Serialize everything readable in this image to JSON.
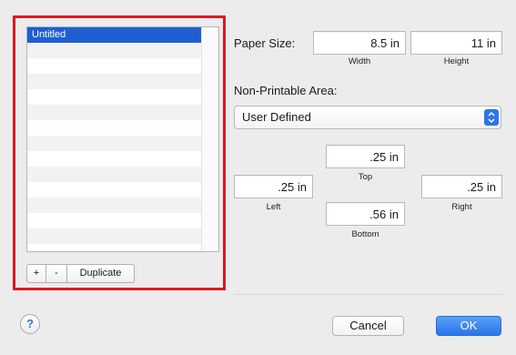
{
  "list": {
    "items": [
      "Untitled"
    ],
    "empty_rows": 13,
    "selected_color": "#1f5fd1"
  },
  "list_buttons": {
    "add": "+",
    "remove": "-",
    "duplicate": "Duplicate"
  },
  "paper_size": {
    "label": "Paper Size:",
    "width_value": "8.5 in",
    "width_caption": "Width",
    "height_value": "11 in",
    "height_caption": "Height"
  },
  "non_printable": {
    "label": "Non-Printable Area:",
    "selected": "User Defined",
    "top_value": ".25 in",
    "top_caption": "Top",
    "left_value": ".25 in",
    "left_caption": "Left",
    "right_value": ".25 in",
    "right_caption": "Right",
    "bottom_value": ".56 in",
    "bottom_caption": "Bottom"
  },
  "footer": {
    "help": "?",
    "cancel": "Cancel",
    "ok": "OK"
  },
  "colors": {
    "highlight": "#e0161e",
    "accent": "#2e75e6"
  }
}
